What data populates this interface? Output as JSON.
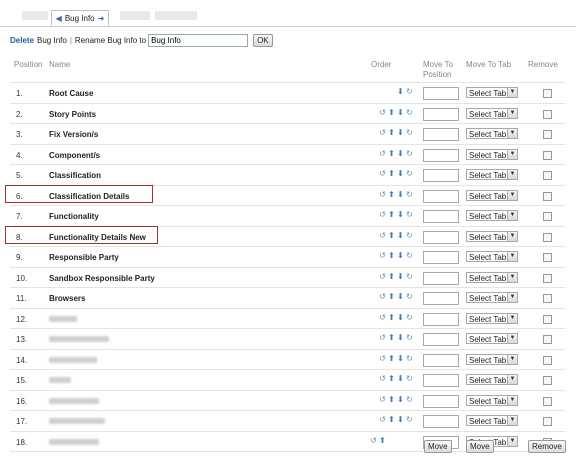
{
  "tabs": {
    "active_label": "Bug Info"
  },
  "toolbar": {
    "delete_label": "Delete",
    "bug_info_label": "Bug Info",
    "sep": "|",
    "rename_label": "Rename Bug Info to",
    "rename_value": "Bug Info",
    "ok_label": "OK"
  },
  "headers": {
    "position": "Position",
    "name": "Name",
    "order": "Order",
    "move_to_position_1": "Move To",
    "move_to_position_2": "Position",
    "move_to_tab": "Move To Tab",
    "remove": "Remove"
  },
  "select_tab_label": "Select Tab",
  "rows": [
    {
      "pos": "1.",
      "name": "Root Cause"
    },
    {
      "pos": "2.",
      "name": "Story Points"
    },
    {
      "pos": "3.",
      "name": "Fix Version/s"
    },
    {
      "pos": "4.",
      "name": "Component/s"
    },
    {
      "pos": "5.",
      "name": "Classification"
    },
    {
      "pos": "6.",
      "name": "Classification Details"
    },
    {
      "pos": "7.",
      "name": "Functionality"
    },
    {
      "pos": "8.",
      "name": "Functionality Details New"
    },
    {
      "pos": "9.",
      "name": "Responsible Party"
    },
    {
      "pos": "10.",
      "name": "Sandbox Responsible Party"
    },
    {
      "pos": "11.",
      "name": "Browsers"
    },
    {
      "pos": "12.",
      "name": ""
    },
    {
      "pos": "13.",
      "name": ""
    },
    {
      "pos": "14.",
      "name": ""
    },
    {
      "pos": "15.",
      "name": ""
    },
    {
      "pos": "16.",
      "name": ""
    },
    {
      "pos": "17.",
      "name": ""
    },
    {
      "pos": "18.",
      "name": ""
    }
  ],
  "footer": {
    "move_label": "Move",
    "move_tab_label": "Move",
    "remove_label": "Remove"
  },
  "colors": {
    "link": "#1f5fa8",
    "highlight_box": "#a03030",
    "icon": "#3f7fbf"
  }
}
